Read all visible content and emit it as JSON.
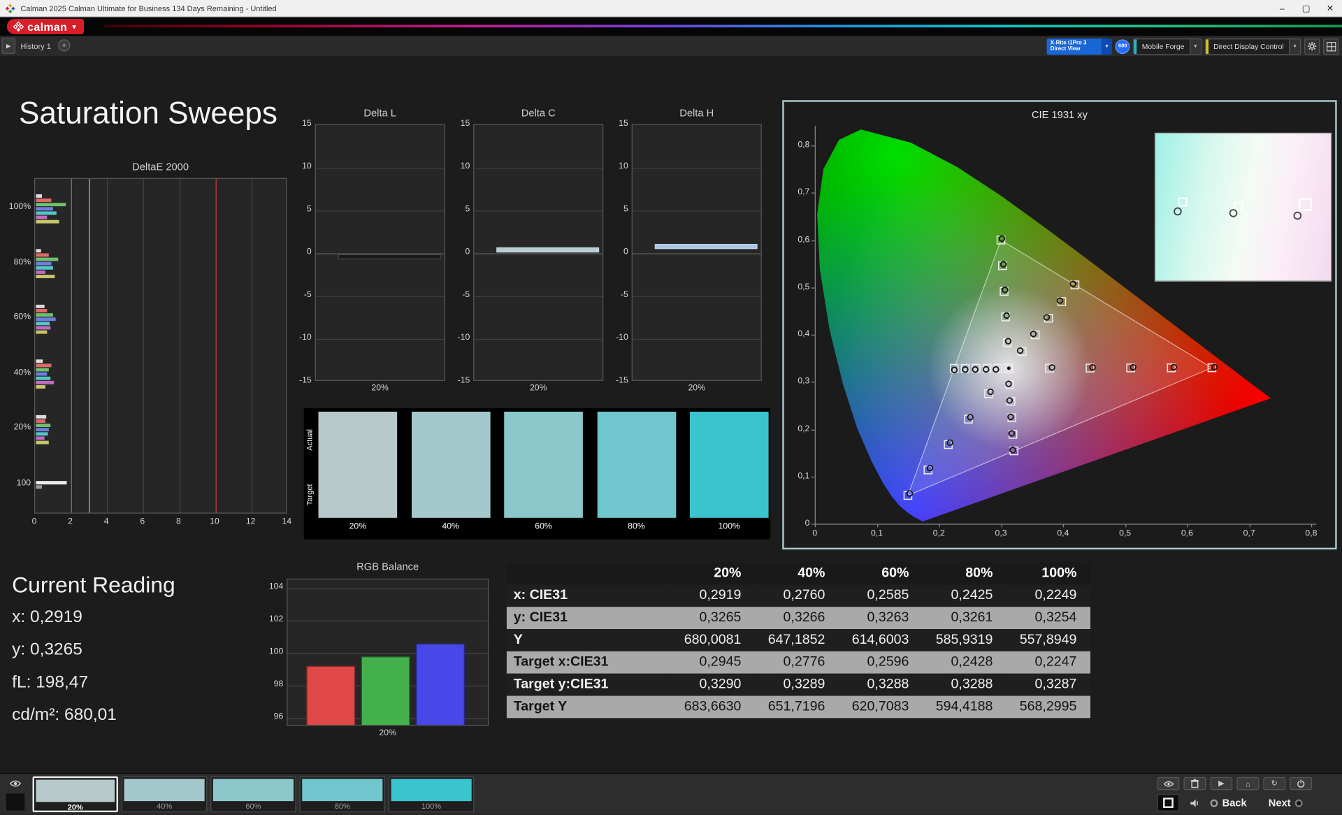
{
  "window": {
    "title": "Calman 2025 Calman Ultimate for Business 134 Days Remaining  - Untitled",
    "logo_text": "calman",
    "minimize": "–",
    "maximize": "▢",
    "close": "✕"
  },
  "icons": {
    "chevron": "▾",
    "play": "▶",
    "plus": "+",
    "home": "⌂",
    "refresh": "↻"
  },
  "toolbar": {
    "history_tab": "History 1",
    "meter_line1": "X-Rite i1Pro 3",
    "meter_line2": "Direct View",
    "badge": "690",
    "source": "Mobile Forge",
    "display": "Direct Display Control"
  },
  "main": {
    "title": "Saturation Sweeps"
  },
  "de_chart": {
    "title": "DeltaE 2000",
    "x_ticks": [
      "0",
      "2",
      "4",
      "6",
      "8",
      "10",
      "12",
      "14"
    ],
    "x_max": 14,
    "thresholds": [
      {
        "value": 2,
        "color": "#22b322"
      },
      {
        "value": 3,
        "color": "#c9c932"
      },
      {
        "value": 10,
        "color": "#d03232"
      }
    ],
    "groups": [
      {
        "label": "100%",
        "bars": [
          {
            "color": "#dcdcdc",
            "value": 0.35
          },
          {
            "color": "#e06a6a",
            "value": 0.85
          },
          {
            "color": "#6fbf6f",
            "value": 1.65
          },
          {
            "color": "#6f7fe0",
            "value": 0.95
          },
          {
            "color": "#54c6c6",
            "value": 1.15
          },
          {
            "color": "#c06ac0",
            "value": 0.6
          },
          {
            "color": "#c6c66a",
            "value": 1.3
          }
        ]
      },
      {
        "label": "80%",
        "bars": [
          {
            "color": "#dcdcdc",
            "value": 0.3
          },
          {
            "color": "#e06a6a",
            "value": 0.7
          },
          {
            "color": "#6fbf6f",
            "value": 1.25
          },
          {
            "color": "#6f7fe0",
            "value": 0.85
          },
          {
            "color": "#54c6c6",
            "value": 0.95
          },
          {
            "color": "#c06ac0",
            "value": 0.5
          },
          {
            "color": "#c6c66a",
            "value": 1.05
          }
        ]
      },
      {
        "label": "60%",
        "bars": [
          {
            "color": "#dcdcdc",
            "value": 0.45
          },
          {
            "color": "#e06a6a",
            "value": 0.6
          },
          {
            "color": "#6fbf6f",
            "value": 0.95
          },
          {
            "color": "#6f7fe0",
            "value": 1.1
          },
          {
            "color": "#54c6c6",
            "value": 0.75
          },
          {
            "color": "#c06ac0",
            "value": 0.8
          },
          {
            "color": "#c6c66a",
            "value": 0.6
          }
        ]
      },
      {
        "label": "40%",
        "bars": [
          {
            "color": "#dcdcdc",
            "value": 0.4
          },
          {
            "color": "#e06a6a",
            "value": 0.85
          },
          {
            "color": "#6fbf6f",
            "value": 0.7
          },
          {
            "color": "#6f7fe0",
            "value": 0.6
          },
          {
            "color": "#54c6c6",
            "value": 0.8
          },
          {
            "color": "#c06ac0",
            "value": 1.0
          },
          {
            "color": "#c6c66a",
            "value": 0.5
          }
        ]
      },
      {
        "label": "20%",
        "bars": [
          {
            "color": "#dcdcdc",
            "value": 0.55
          },
          {
            "color": "#e06a6a",
            "value": 0.5
          },
          {
            "color": "#6fbf6f",
            "value": 0.8
          },
          {
            "color": "#6f7fe0",
            "value": 0.7
          },
          {
            "color": "#54c6c6",
            "value": 0.65
          },
          {
            "color": "#c06ac0",
            "value": 0.45
          },
          {
            "color": "#c6c66a",
            "value": 0.7
          }
        ]
      },
      {
        "label": "100",
        "bars": [
          {
            "color": "#ececec",
            "value": 1.7
          },
          {
            "color": "#9a9a9a",
            "value": 0.35
          }
        ]
      }
    ]
  },
  "delta_axis": {
    "y_ticks": [
      15,
      10,
      5,
      0,
      -5,
      -10,
      -15
    ],
    "y_max": 15
  },
  "delta_charts": [
    {
      "title": "Delta L",
      "x_label": "20%",
      "value": -0.3,
      "color": "#17191d"
    },
    {
      "title": "Delta C",
      "x_label": "20%",
      "value": 0.5,
      "color": "#b7ced2"
    },
    {
      "title": "Delta H",
      "x_label": "20%",
      "value": 0.9,
      "color": "#a9c6e2"
    }
  ],
  "swatch_panel": {
    "row_labels": [
      "Actual",
      "Target"
    ],
    "items": [
      {
        "label": "20%",
        "color": "#b7c9ca"
      },
      {
        "label": "40%",
        "color": "#a4c8cb"
      },
      {
        "label": "60%",
        "color": "#8bc7cb"
      },
      {
        "label": "80%",
        "color": "#6fc6cd"
      },
      {
        "label": "100%",
        "color": "#3ac4ce"
      }
    ]
  },
  "cie": {
    "title": "CIE 1931 xy",
    "x_ticks": [
      "0",
      "0,1",
      "0,2",
      "0,3",
      "0,4",
      "0,5",
      "0,6",
      "0,7",
      "0,8"
    ],
    "y_ticks": [
      "0",
      "0,1",
      "0,2",
      "0,3",
      "0,4",
      "0,5",
      "0,6",
      "0,7",
      "0,8"
    ],
    "white": [
      0.3127,
      0.329
    ],
    "gamut": {
      "red": [
        0.64,
        0.33
      ],
      "green": [
        0.3,
        0.6
      ],
      "blue": [
        0.15,
        0.06
      ]
    },
    "sweeps": [
      {
        "name": "red",
        "end": [
          0.64,
          0.33
        ]
      },
      {
        "name": "yellow",
        "end": [
          0.4193,
          0.5053
        ]
      },
      {
        "name": "green",
        "end": [
          0.3,
          0.6
        ]
      },
      {
        "name": "cyan",
        "end": [
          0.2247,
          0.3287
        ]
      },
      {
        "name": "blue",
        "end": [
          0.15,
          0.06
        ]
      },
      {
        "name": "magenta",
        "end": [
          0.3209,
          0.1542
        ]
      }
    ],
    "fractions": [
      0.2,
      0.4,
      0.6,
      0.8,
      1
    ],
    "measured_cyan": [
      [
        0.2919,
        0.3265
      ],
      [
        0.276,
        0.3266
      ],
      [
        0.2585,
        0.3263
      ],
      [
        0.2425,
        0.3261
      ],
      [
        0.2249,
        0.3254
      ]
    ],
    "inset": {
      "circles": [
        [
          26,
          91
        ],
        [
          91,
          93
        ],
        [
          166,
          96
        ]
      ],
      "squares": [
        [
          32,
          80,
          9
        ],
        [
          97,
          85,
          9
        ],
        [
          175,
          83,
          13
        ]
      ]
    }
  },
  "current_reading": {
    "title": "Current Reading",
    "lines": [
      "x: 0,2919",
      "y: 0,3265",
      "fL: 198,47",
      "cd/m²: 680,01"
    ]
  },
  "rgb_chart": {
    "title": "RGB Balance",
    "x_label": "20%",
    "y_ticks": [
      104,
      102,
      100,
      98,
      96
    ],
    "y_min": 95.5,
    "y_max": 104.5,
    "bars": [
      {
        "color": "#e04848",
        "value": 99.2
      },
      {
        "color": "#44b04c",
        "value": 99.8
      },
      {
        "color": "#4848e8",
        "value": 100.6
      }
    ]
  },
  "table": {
    "headers": [
      "20%",
      "40%",
      "60%",
      "80%",
      "100%"
    ],
    "rows": [
      {
        "label": "x: CIE31",
        "values": [
          "0,2919",
          "0,2760",
          "0,2585",
          "0,2425",
          "0,2249"
        ]
      },
      {
        "label": "y: CIE31",
        "values": [
          "0,3265",
          "0,3266",
          "0,3263",
          "0,3261",
          "0,3254"
        ]
      },
      {
        "label": "Y",
        "values": [
          "680,0081",
          "647,1852",
          "614,6003",
          "585,9319",
          "557,8949"
        ]
      },
      {
        "label": "Target x:CIE31",
        "values": [
          "0,2945",
          "0,2776",
          "0,2596",
          "0,2428",
          "0,2247"
        ]
      },
      {
        "label": "Target y:CIE31",
        "values": [
          "0,3290",
          "0,3289",
          "0,3288",
          "0,3288",
          "0,3287"
        ]
      },
      {
        "label": "Target Y",
        "values": [
          "683,6630",
          "651,7196",
          "620,7083",
          "594,4188",
          "568,2995"
        ]
      }
    ]
  },
  "bottom_bar": {
    "back": "Back",
    "next": "Next",
    "buttons": [
      {
        "label": "20%",
        "color": "#b7c9ca",
        "selected": true
      },
      {
        "label": "40%",
        "color": "#a4c8cb",
        "selected": false
      },
      {
        "label": "60%",
        "color": "#8bc7cb",
        "selected": false
      },
      {
        "label": "80%",
        "color": "#6fc6cd",
        "selected": false
      },
      {
        "label": "100%",
        "color": "#3ac4ce",
        "selected": false
      }
    ]
  }
}
